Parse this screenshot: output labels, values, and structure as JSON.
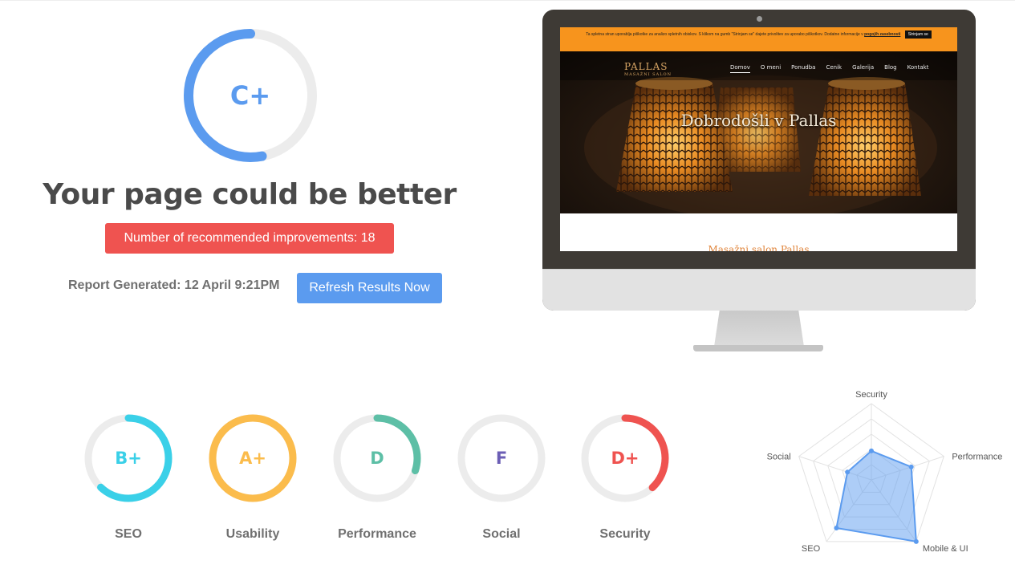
{
  "summary": {
    "overall_grade": "C+",
    "overall_score": 0.53,
    "headline": "Your page could be better",
    "improvements_text": "Number of recommended improvements: 18",
    "report_generated": "Report Generated: 12 April 9:21PM",
    "refresh_label": "Refresh Results Now"
  },
  "preview": {
    "cookie_text": "Ta spletna stran uporablja piškotke za analizo spletnih obiskov. S klikom na gumb \"Strinjam se\" dajete privolitev za uporabo piškotkov. Dodatne informacije v",
    "cookie_link": "pogojih zasebnosti",
    "cookie_button": "Strinjam se",
    "logo": "PALLAS",
    "logo_sub": "MASAŽNI SALON",
    "nav": [
      "Domov",
      "O meni",
      "Ponudba",
      "Cenik",
      "Galerija",
      "Blog",
      "Kontakt"
    ],
    "hero_title": "Dobrodošli v Pallas",
    "below_fold": "Masažni salon Pallas"
  },
  "categories": [
    {
      "label": "SEO",
      "grade": "B+",
      "score": 0.62,
      "color": "#3ad0e8"
    },
    {
      "label": "Usability",
      "grade": "A+",
      "score": 1.0,
      "color": "#fbbc4c"
    },
    {
      "label": "Performance",
      "grade": "D",
      "score": 0.3,
      "color": "#5dbfa6"
    },
    {
      "label": "Social",
      "grade": "F",
      "score": 0.0,
      "color": "#6b5eb5"
    },
    {
      "label": "Security",
      "grade": "D+",
      "score": 0.38,
      "color": "#ef5350"
    }
  ],
  "radar": {
    "axes": [
      "Security",
      "Performance",
      "Mobile & UI",
      "SEO",
      "Social"
    ],
    "values": [
      0.38,
      0.55,
      1.0,
      0.78,
      0.33
    ],
    "color": "#5b9bef"
  }
}
